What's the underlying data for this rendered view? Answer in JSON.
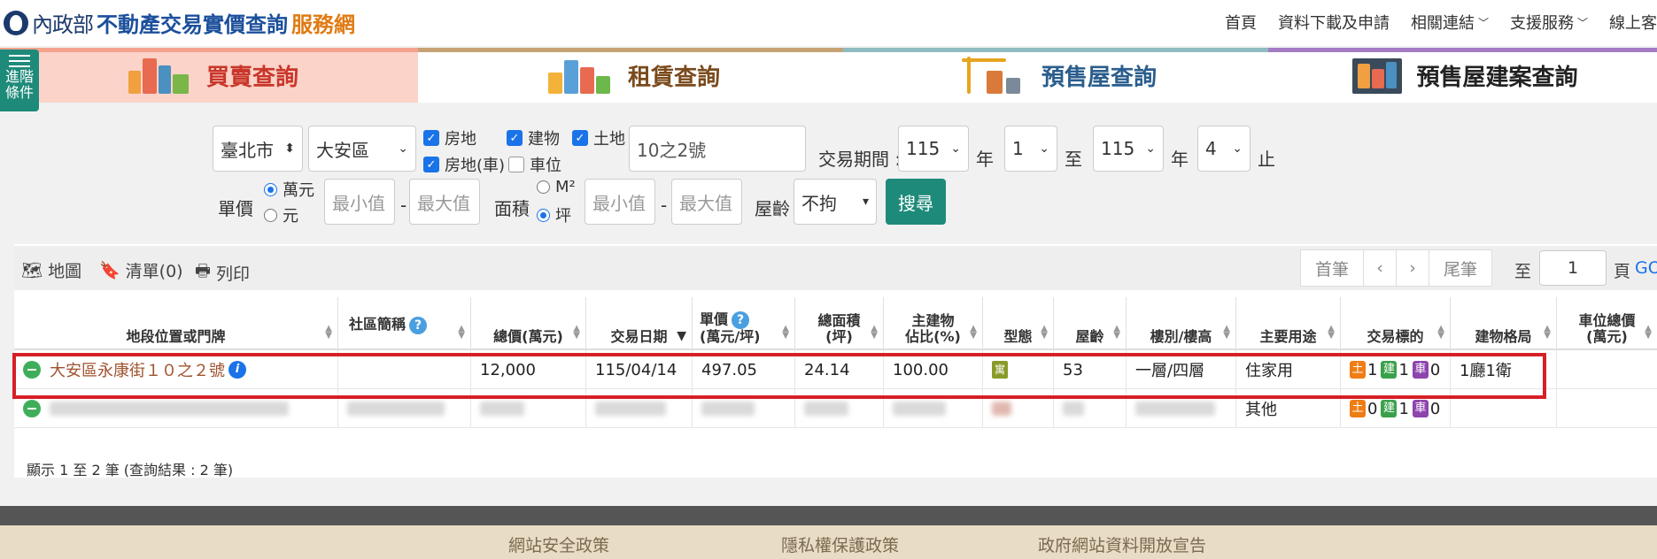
{
  "header": {
    "ministry": "內政部",
    "title": "不動產交易實價查詢",
    "subtitle": "服務網",
    "nav": [
      {
        "label": "首頁",
        "dropdown": false
      },
      {
        "label": "資料下載及申請",
        "dropdown": false
      },
      {
        "label": "相關連結",
        "dropdown": true
      },
      {
        "label": "支援服務",
        "dropdown": true
      },
      {
        "label": "線上客",
        "dropdown": false
      }
    ]
  },
  "advanced": {
    "line1": "進階",
    "line2": "條件"
  },
  "tabs": [
    {
      "label": "買賣查詢",
      "active": true
    },
    {
      "label": "租賃查詢",
      "active": false
    },
    {
      "label": "預售屋查詢",
      "active": false
    },
    {
      "label": "預售屋建案查詢",
      "active": false
    }
  ],
  "filters": {
    "city": "臺北市",
    "district": "大安區",
    "checkboxes": {
      "land_building": {
        "label": "房地",
        "checked": true
      },
      "building": {
        "label": "建物",
        "checked": true
      },
      "land": {
        "label": "土地",
        "checked": true
      },
      "land_building_parking": {
        "label": "房地(車)",
        "checked": true
      },
      "parking": {
        "label": "車位",
        "checked": false
      }
    },
    "keyword": "10之2號",
    "period_label": "交易期間 :",
    "from_year": "115",
    "year_label": "年",
    "from_month": "1",
    "to_label": "至",
    "to_year": "115",
    "to_month": "4",
    "end_label": "止",
    "unit_price_label": "單價",
    "unit_wan": "萬元",
    "unit_yuan": "元",
    "unit_selected": "萬元",
    "min_placeholder": "最小值",
    "max_placeholder": "最大值",
    "dash": "-",
    "area_label": "面積",
    "area_m2": "M²",
    "area_ping": "坪",
    "area_selected": "坪",
    "age_label": "屋齡",
    "age_value": "不拘",
    "search_label": "搜尋"
  },
  "toolbar": {
    "map": "地圖",
    "list": "清單(0)",
    "print": "列印",
    "first": "首筆",
    "prev": "‹",
    "next": "›",
    "last": "尾筆",
    "goto_label": "至",
    "page_value": "1",
    "page_label": "頁",
    "go": "GO"
  },
  "table": {
    "headers": [
      {
        "line1": "地段位置或門牌",
        "line2": ""
      },
      {
        "line1": "社區簡稱",
        "line2": "",
        "help": true
      },
      {
        "line1": "總價(萬元)",
        "line2": ""
      },
      {
        "line1": "交易日期",
        "line2": "",
        "sorted": true
      },
      {
        "line1": "單價",
        "line2": "(萬元/坪)",
        "help": true
      },
      {
        "line1": "總面積",
        "line2": "(坪)"
      },
      {
        "line1": "主建物",
        "line2": "佔比(%)"
      },
      {
        "line1": "型態",
        "line2": ""
      },
      {
        "line1": "屋齡",
        "line2": ""
      },
      {
        "line1": "樓別/樓高",
        "line2": ""
      },
      {
        "line1": "主要用途",
        "line2": ""
      },
      {
        "line1": "交易標的",
        "line2": ""
      },
      {
        "line1": "建物格局",
        "line2": ""
      },
      {
        "line1": "車位總價",
        "line2": "(萬元)"
      }
    ],
    "rows": [
      {
        "address": "大安區永康街１０之２號",
        "community": "",
        "total_price": "12,000",
        "date": "115/04/14",
        "unit_price": "497.05",
        "area": "24.14",
        "main_ratio": "100.00",
        "type_badge": "寓",
        "age": "53",
        "floor": "一層/四層",
        "usage": "住家用",
        "tx_land": "土",
        "tx_land_count": "1",
        "tx_build": "建",
        "tx_build_count": "1",
        "tx_car": "車",
        "tx_car_count": "0",
        "layout": "1廳1衛",
        "parking_price": ""
      },
      {
        "address": "",
        "usage": "其他",
        "tx_land": "土",
        "tx_land_count": "0",
        "tx_build": "建",
        "tx_build_count": "1",
        "tx_car": "車",
        "tx_car_count": "0"
      }
    ]
  },
  "footnote": "顯示 1 至 2 筆 (查詢結果 : 2 筆)",
  "footer": {
    "links": [
      "網站安全政策",
      "隱私權保護政策",
      "政府網站資料開放宣告"
    ]
  }
}
